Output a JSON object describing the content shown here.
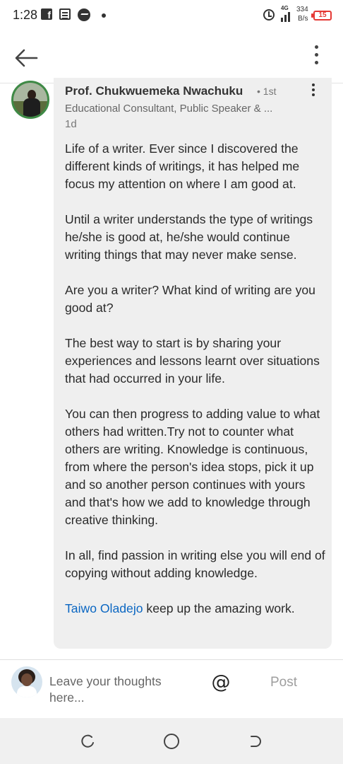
{
  "status_bar": {
    "time": "1:28",
    "network_label": "4G",
    "speed_value": "334",
    "speed_unit": "B/s",
    "battery_level": "15",
    "icons": [
      "facebook-icon",
      "document-icon",
      "messenger-icon",
      "dot-icon",
      "alarm-icon",
      "signal-icon",
      "battery-icon"
    ]
  },
  "app_bar": {
    "icons": [
      "back-arrow-icon",
      "more-vertical-icon"
    ]
  },
  "comment": {
    "author_name": "Prof. Chukwuemeka Nwachuku",
    "connection_degree": "• 1st",
    "headline": "Educational Consultant, Public Speaker & ...",
    "age": "1d",
    "paragraphs": [
      "Life of a writer. Ever since I discovered the different kinds of writings, it has helped me focus my attention on where I am good at.",
      "Until a writer understands the type of writings he/she is good at, he/she would continue writing things that may never make sense.",
      "Are you a writer? What kind of writing are you good at?",
      "The best way to start is by sharing your experiences and lessons learnt over situations that had occurred in your life.",
      "You can then progress to adding value to what others had written.Try not to counter what others are writing. Knowledge is continuous, from where the person's idea stops, pick it up and so another person continues with yours and that's how we add to knowledge through creative thinking.",
      "In all, find passion in writing else you will end of copying without adding knowledge."
    ],
    "mention_name": "Taiwo Oladejo",
    "mention_suffix": " keep up the amazing work."
  },
  "composer": {
    "placeholder": "Leave your thoughts here...",
    "mention_symbol": "@",
    "post_label": "Post"
  },
  "colors": {
    "link": "#0a66c2",
    "bubble_background": "#efefef",
    "battery_low": "#e53935",
    "avatar_ring": "#3e8a46"
  }
}
